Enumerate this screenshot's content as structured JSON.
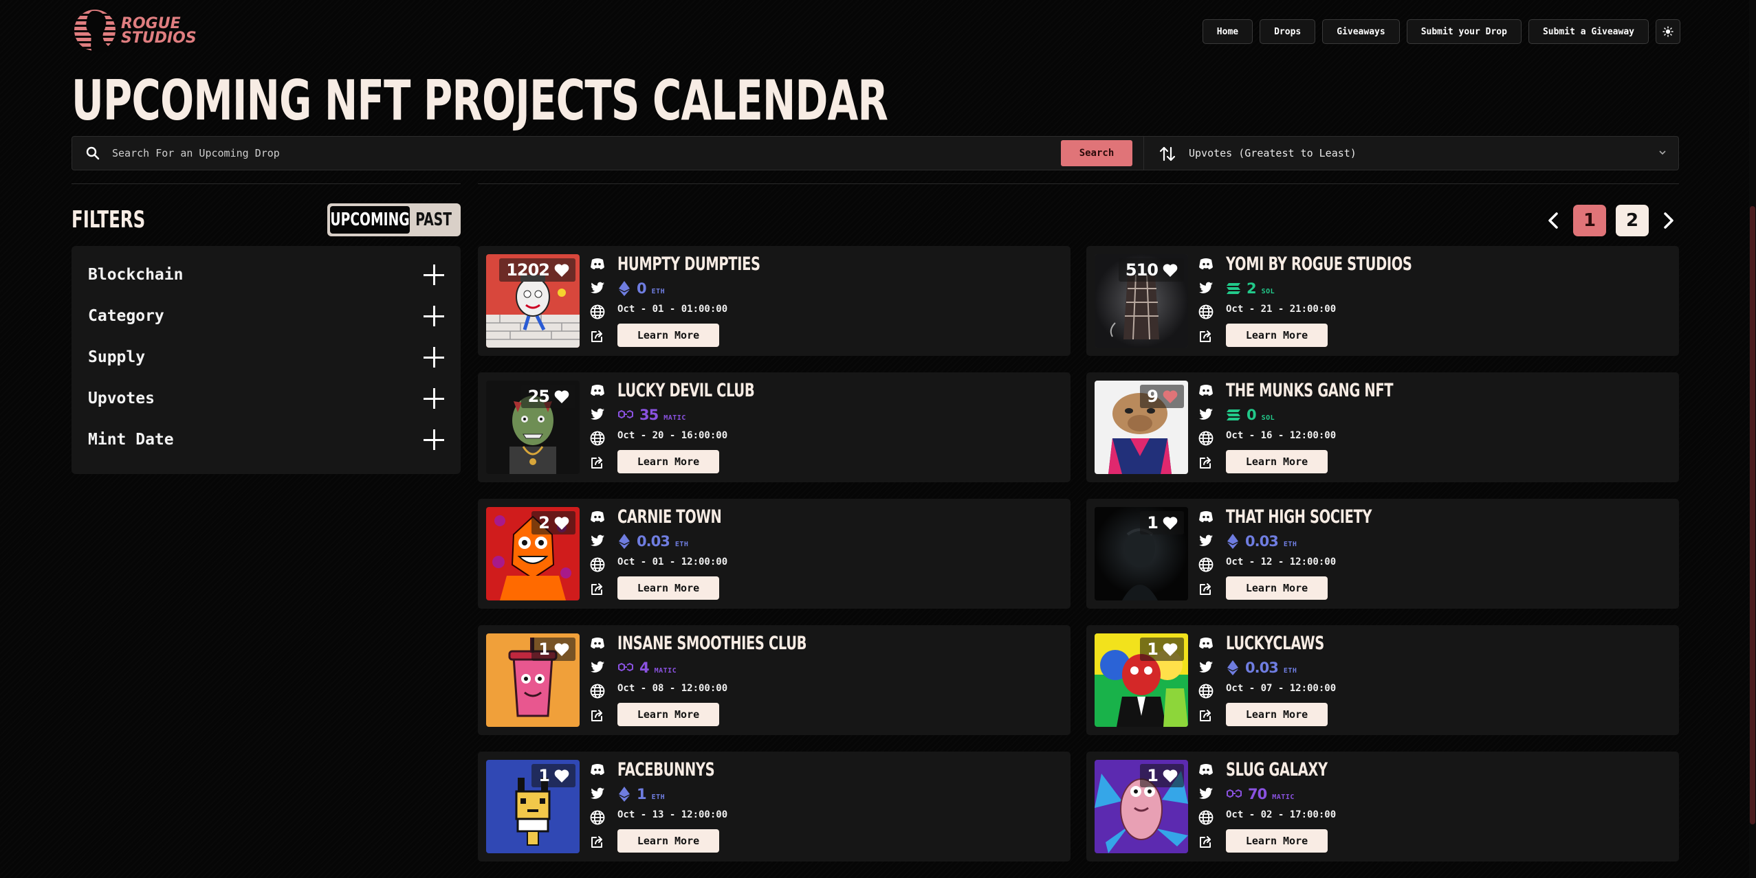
{
  "header": {
    "logo_text_line1": "ROGUE",
    "logo_text_line2": "STUDIOS",
    "nav": [
      "Home",
      "Drops",
      "Giveaways",
      "Submit your Drop",
      "Submit a Giveaway"
    ]
  },
  "page_title": "UPCOMING NFT PROJECTS CALENDAR",
  "search": {
    "placeholder": "Search For an Upcoming Drop",
    "button_label": "Search",
    "sort_label": "Upvotes (Greatest to Least)"
  },
  "filters": {
    "title": "FILTERS",
    "toggle": [
      "UPCOMING",
      "PAST"
    ],
    "groups": [
      "Blockchain",
      "Category",
      "Supply",
      "Upvotes",
      "Mint Date"
    ]
  },
  "pagination": {
    "pages": [
      "1",
      "2"
    ],
    "current": "1"
  },
  "learn_more_label": "Learn More",
  "colors": {
    "accent": "#e07478",
    "cream": "#f7ece4",
    "eth": "#6f7de0",
    "matic": "#8a52e0",
    "sol": "#22c98a",
    "card_bg": "#161616",
    "heart_active": "#e07478"
  },
  "projects": [
    {
      "name": "HUMPTY DUMPTIES",
      "upvotes": "1202",
      "price": "0",
      "unit": "ETH",
      "chain": "eth",
      "date": "Oct - 01 - 01:00:00",
      "art": "humpty",
      "liked": false
    },
    {
      "name": "YOMI BY ROGUE STUDIOS",
      "upvotes": "510",
      "price": "2",
      "unit": "SOL",
      "chain": "sol",
      "date": "Oct - 21 - 21:00:00",
      "art": "yomi",
      "liked": false
    },
    {
      "name": "LUCKY DEVIL CLUB",
      "upvotes": "25",
      "price": "35",
      "unit": "MATIC",
      "chain": "matic",
      "date": "Oct - 20 - 16:00:00",
      "art": "devil",
      "liked": false
    },
    {
      "name": "THE MUNKS GANG NFT",
      "upvotes": "9",
      "price": "0",
      "unit": "SOL",
      "chain": "sol",
      "date": "Oct - 16 - 12:00:00",
      "art": "munks",
      "liked": true
    },
    {
      "name": "CARNIE TOWN",
      "upvotes": "2",
      "price": "0.03",
      "unit": "ETH",
      "chain": "eth",
      "date": "Oct - 01 - 12:00:00",
      "art": "carnie",
      "liked": false
    },
    {
      "name": "THAT HIGH SOCIETY",
      "upvotes": "1",
      "price": "0.03",
      "unit": "ETH",
      "chain": "eth",
      "date": "Oct - 12 - 12:00:00",
      "art": "society",
      "liked": false
    },
    {
      "name": "INSANE SMOOTHIES CLUB",
      "upvotes": "1",
      "price": "4",
      "unit": "MATIC",
      "chain": "matic",
      "date": "Oct - 08 - 12:00:00",
      "art": "smoothie",
      "liked": false
    },
    {
      "name": "LUCKYCLAWS",
      "upvotes": "1",
      "price": "0.03",
      "unit": "ETH",
      "chain": "eth",
      "date": "Oct - 07 - 12:00:00",
      "art": "claws",
      "liked": false
    },
    {
      "name": "FACEBUNNYS",
      "upvotes": "1",
      "price": "1",
      "unit": "ETH",
      "chain": "eth",
      "date": "Oct - 13 - 12:00:00",
      "art": "bunny",
      "liked": false
    },
    {
      "name": "SLUG GALAXY",
      "upvotes": "1",
      "price": "70",
      "unit": "MATIC",
      "chain": "matic",
      "date": "Oct - 02 - 17:00:00",
      "art": "slug",
      "liked": false
    }
  ]
}
